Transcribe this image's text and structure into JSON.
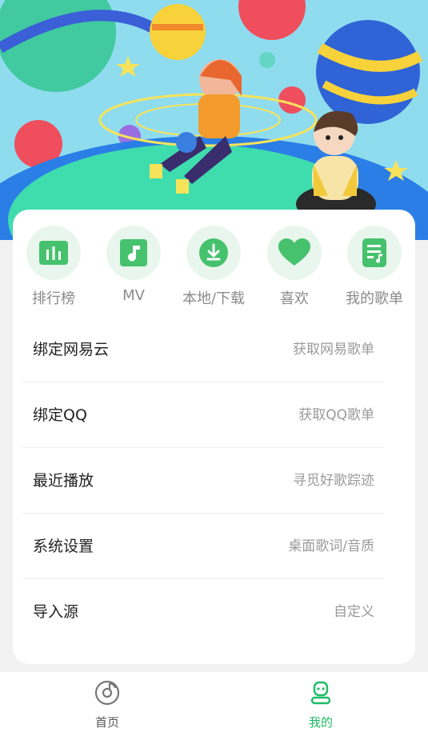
{
  "colors": {
    "accent": "#1ebc66",
    "quick_bg": "#e9f6ed",
    "quick_icon": "#46c16d"
  },
  "quick_actions": [
    {
      "label": "排行榜",
      "icon": "chart-bars-icon"
    },
    {
      "label": "MV",
      "icon": "music-note-icon"
    },
    {
      "label": "本地/下载",
      "icon": "download-icon"
    },
    {
      "label": "喜欢",
      "icon": "heart-icon"
    },
    {
      "label": "我的歌单",
      "icon": "playlist-icon"
    }
  ],
  "menu": [
    {
      "title": "绑定网易云",
      "subtitle": "获取网易歌单"
    },
    {
      "title": "绑定QQ",
      "subtitle": "获取QQ歌单"
    },
    {
      "title": "最近播放",
      "subtitle": "寻觅好歌踪迹"
    },
    {
      "title": "系统设置",
      "subtitle": "桌面歌词/音质"
    },
    {
      "title": "导入源",
      "subtitle": "自定义"
    }
  ],
  "bottom_nav": [
    {
      "label": "首页",
      "icon": "disc-icon",
      "active": false
    },
    {
      "label": "我的",
      "icon": "user-icon",
      "active": true
    }
  ]
}
